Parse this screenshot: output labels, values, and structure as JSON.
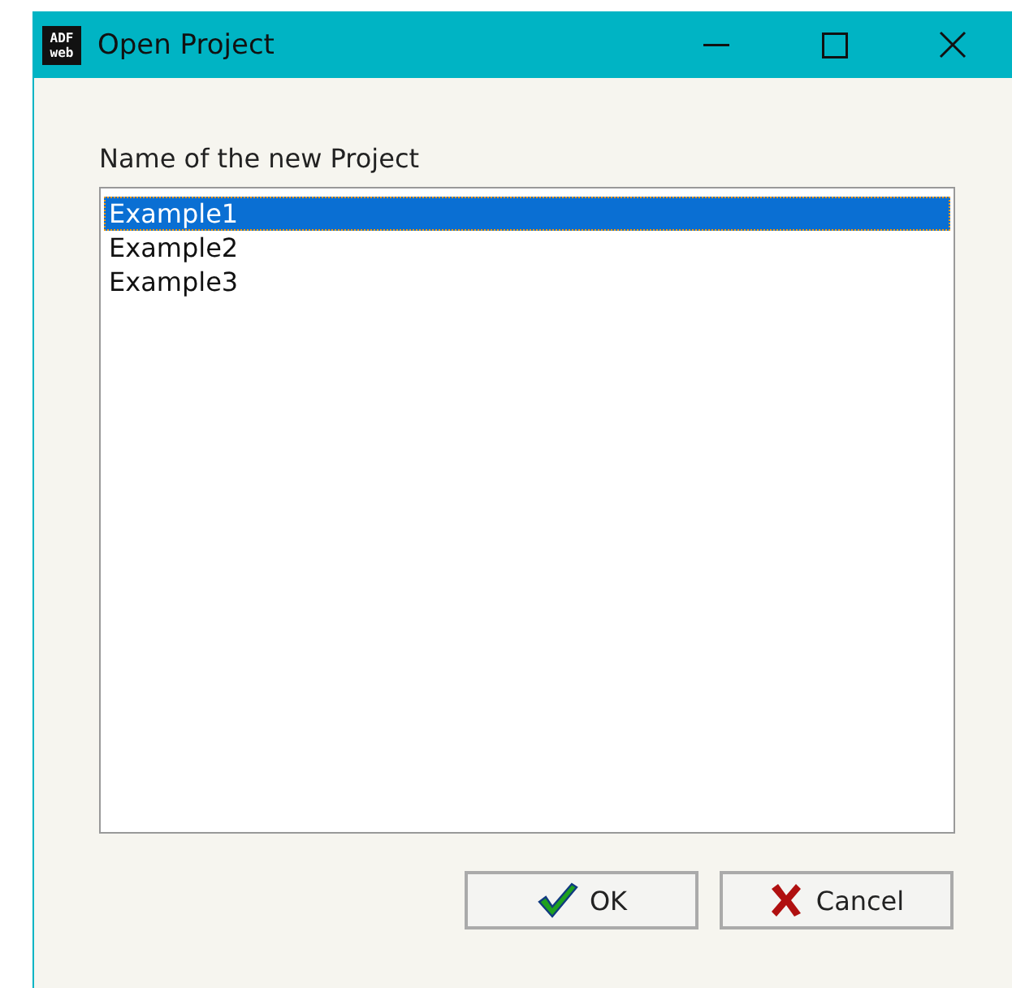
{
  "window": {
    "title": "Open Project",
    "app_icon_text": [
      "ADF",
      "web"
    ]
  },
  "label": "Name of the new Project",
  "projects": [
    {
      "name": "Example1",
      "selected": true
    },
    {
      "name": "Example2",
      "selected": false
    },
    {
      "name": "Example3",
      "selected": false
    }
  ],
  "buttons": [
    {
      "kind": "ok",
      "label": "OK"
    },
    {
      "kind": "cancel",
      "label": "Cancel"
    }
  ]
}
